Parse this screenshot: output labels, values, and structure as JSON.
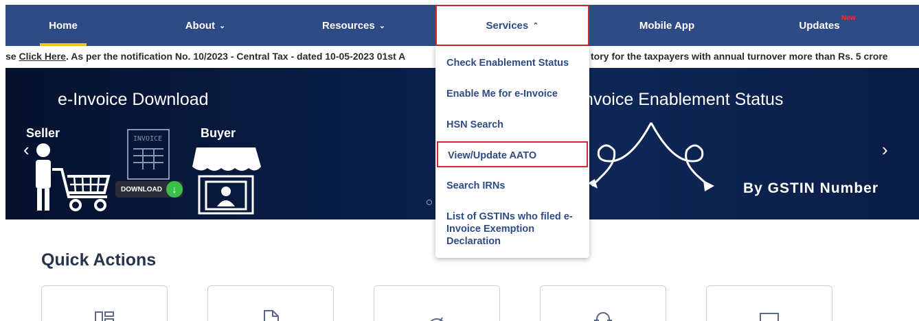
{
  "nav": {
    "home": "Home",
    "about": "About",
    "resources": "Resources",
    "services": "Services",
    "mobile_app": "Mobile App",
    "updates": "Updates",
    "new_badge": "New"
  },
  "ticker": {
    "prefix": "se ",
    "link": "Click Here",
    "text": ". As per the notification No. 10/2023 - Central Tax - dated 10-05-2023 01st A",
    "text_right": "tory for the taxpayers with annual turnover more than Rs. 5 crore"
  },
  "banner": {
    "left_title": "e-Invoice Download",
    "right_title": "nvoice Enablement Status",
    "seller": "Seller",
    "buyer": "Buyer",
    "invoice_tag": "INVOICE",
    "download": "DOWNLOAD",
    "by_gstin": "By GSTIN Number"
  },
  "services_menu": {
    "items": [
      "Check Enablement Status",
      "Enable Me for e-Invoice",
      "HSN Search",
      "View/Update AATO",
      "Search IRNs",
      "List of GSTINs who filed e-Invoice Exemption Declaration"
    ]
  },
  "quick_actions": {
    "title": "Quick Actions"
  },
  "colors": {
    "nav_bg": "#2e4b86",
    "highlight": "#d7262c",
    "accent": "#f0c419"
  }
}
